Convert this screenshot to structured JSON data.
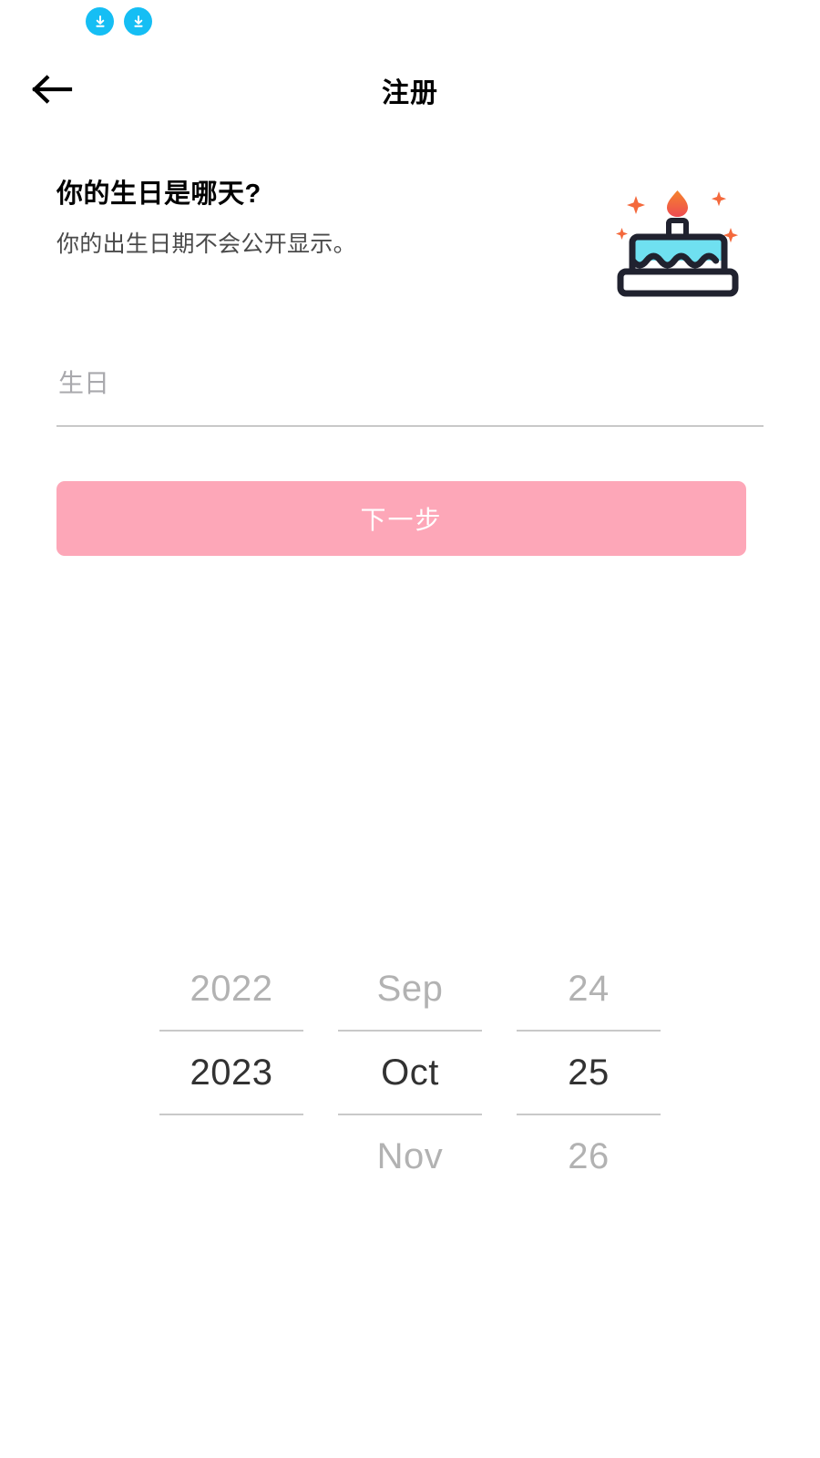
{
  "top_badges": [
    {
      "icon": "download-icon",
      "color": "#15BEF4"
    },
    {
      "icon": "download-icon",
      "color": "#15BEF4"
    }
  ],
  "header": {
    "back_icon": "arrow-left-icon",
    "title": "注册"
  },
  "main": {
    "headline": "你的生日是哪天?",
    "subhead": "你的出生日期不会公开显示。",
    "illustration": "birthday-cake-icon"
  },
  "birthday_field": {
    "placeholder": "生日",
    "value": ""
  },
  "next_button": {
    "label": "下一步",
    "background": "#FDA7B8",
    "text_color": "#FFFFFF",
    "enabled": false
  },
  "date_picker": {
    "columns": [
      {
        "name": "year",
        "above": "2022",
        "selected": "2023",
        "below": ""
      },
      {
        "name": "month",
        "above": "Sep",
        "selected": "Oct",
        "below": "Nov"
      },
      {
        "name": "day",
        "above": "24",
        "selected": "25",
        "below": "26"
      }
    ]
  },
  "colors": {
    "accent_pink": "#FDA7B8",
    "badge_cyan": "#15BEF4",
    "cake_frosting": "#6FE0F0",
    "cake_outline": "#20222F",
    "flame_top": "#F5842C",
    "flame_bottom": "#EE4B52",
    "sparkle": "#F4693C",
    "muted_text": "#B2B2B2",
    "selected_text": "#323232"
  }
}
